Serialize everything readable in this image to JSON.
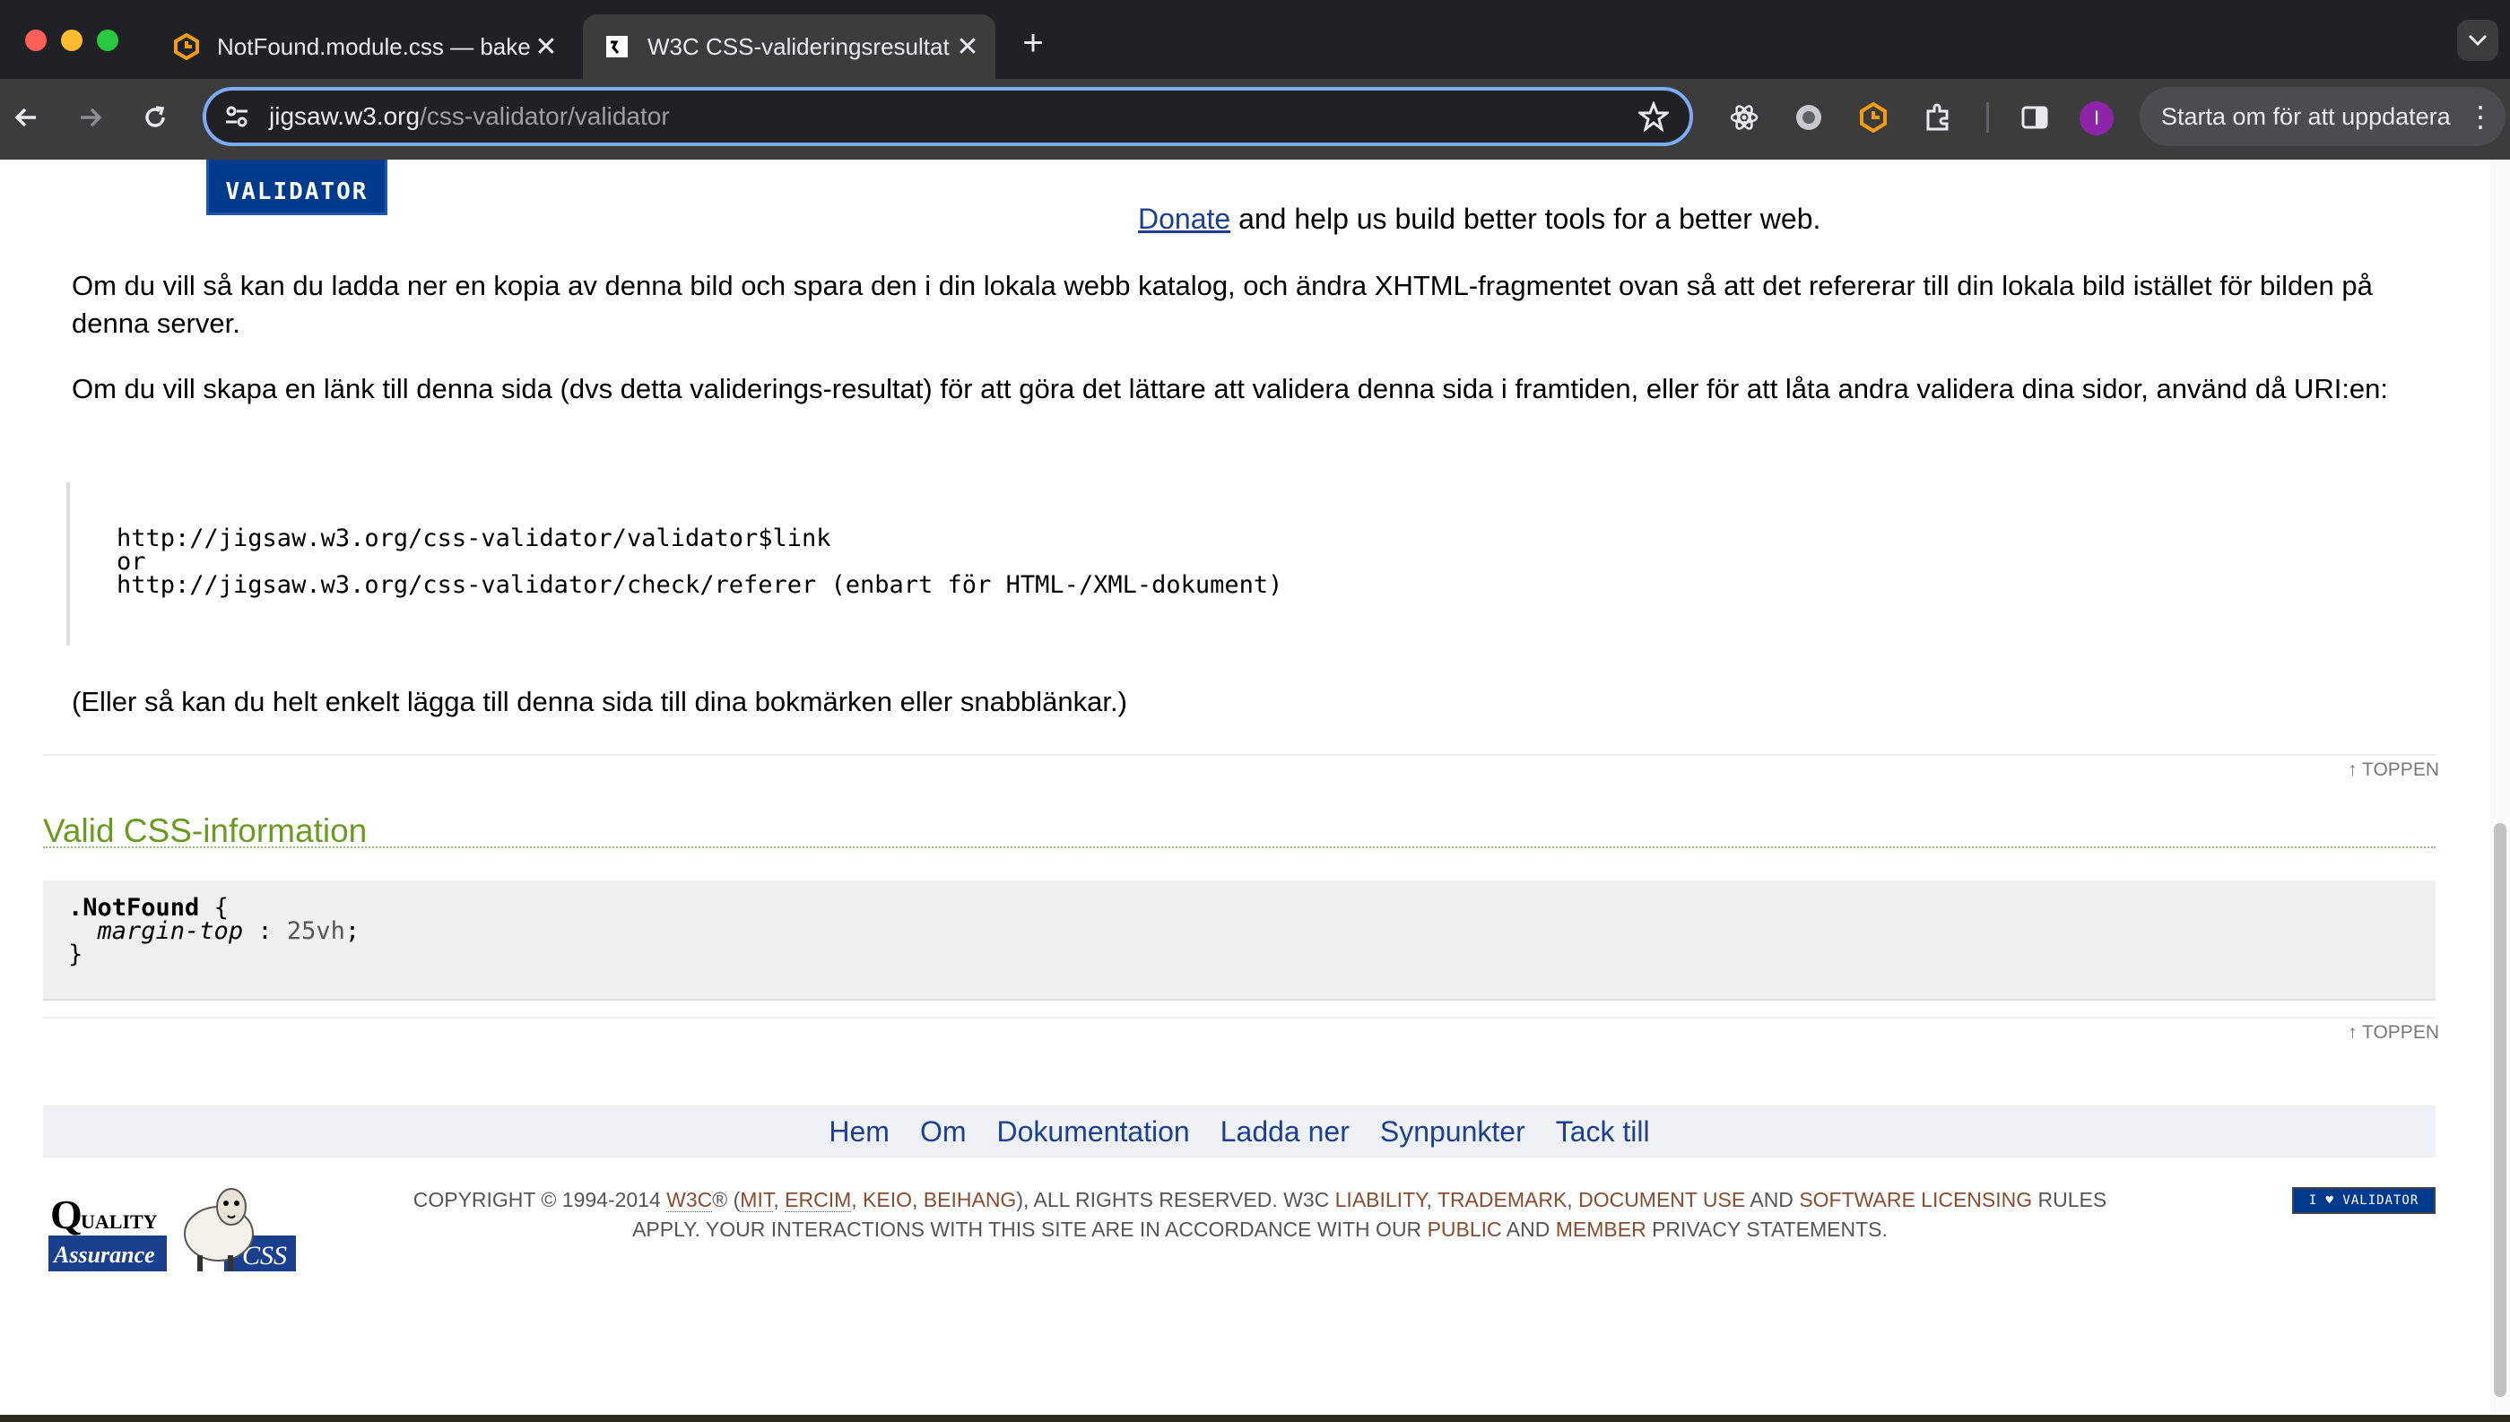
{
  "browser": {
    "tabs": [
      {
        "title": "NotFound.module.css — bake",
        "active": false
      },
      {
        "title": "W3C CSS-valideringsresultat",
        "active": true
      }
    ],
    "url_host": "jigsaw.w3.org",
    "url_path": "/css-validator/validator",
    "update_button": "Starta om för att uppdatera",
    "profile_initial": "I"
  },
  "page": {
    "badge_text": "VALIDATOR",
    "donate": {
      "link": "Donate",
      "text": " and help us build better tools for a better web."
    },
    "para1": "Om du vill så kan du ladda ner en kopia av denna bild och spara den i din lokala webb katalog, och ändra XHTML-fragmentet ovan så att det refererar till din lokala bild istället för bilden på denna server.",
    "para2": "Om du vill skapa en länk till denna sida (dvs detta validerings-resultat) för att göra det lättare att validera denna sida i framtiden, eller för att låta andra validera dina sidor, använd då URI:en:",
    "uri_block": "http://jigsaw.w3.org/css-validator/validator$link\nor\nhttp://jigsaw.w3.org/css-validator/check/referer (enbart för HTML-/XML-dokument)",
    "para3": "(Eller så kan du helt enkelt lägga till denna sida till dina bokmärken eller snabblänkar.)",
    "top_link": "↑ TOPPEN",
    "section_title": "Valid CSS-information",
    "css": {
      "selector": ".NotFound",
      "property": "margin-top",
      "value": "25vh"
    },
    "nav": [
      "Hem",
      "Om",
      "Dokumentation",
      "Ladda ner",
      "Synpunkter",
      "Tack till"
    ],
    "footer": {
      "copyright_pre": "Copyright © 1994-2014 ",
      "w3c": "W3C",
      "reg": "® (",
      "mit": "MIT",
      "ercim": "ERCIM",
      "keio": "Keio",
      "beihang": "Beihang",
      "rights": "), All Rights Reserved. W3C ",
      "liability": "liability",
      "trademark": "trademark",
      "document_use": "document use",
      "and": " and ",
      "software_licensing": "software licensing",
      "rules": " rules apply. Your interactions with this site are in accordance with our ",
      "public": "public",
      "member": "member",
      "privacy": " privacy statements.",
      "qa_logo_text": "Quality Assurance",
      "css_logo_text": "CSS",
      "small_badge": "I ♥ VALIDATOR"
    }
  },
  "colors": {
    "heading_green": "#6a9a1f",
    "link_blue": "#1c3f94",
    "footer_link": "#8a4b2e",
    "omnibox_focus": "#7cacf8"
  }
}
